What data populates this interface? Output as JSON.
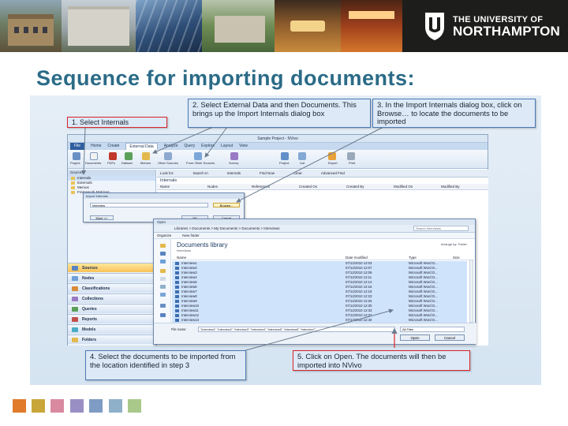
{
  "header": {
    "logo_line1": "THE UNIVERSITY OF",
    "logo_line2": "NORTHAMPTON"
  },
  "title": "Sequence for importing documents:",
  "callouts": {
    "step1": "1. Select Internals",
    "step2": "2. Select External Data and then Documents. This brings up the Import Internals dialog box",
    "step3": "3. In the Import Internals dialog box, click on Browse… to locate the documents to be imported",
    "step4": "4. Select the documents to be imported from the location identified in step 3",
    "step5": "5. Click on Open. The documents will then be imported into NVivo"
  },
  "nvivo": {
    "window_title": "Sample Project - NVivo",
    "tabs": [
      "File",
      "Home",
      "Create",
      "External Data",
      "Analyze",
      "Query",
      "Explore",
      "Layout",
      "View"
    ],
    "ribbon": [
      "Project",
      "Documents",
      "PDFs",
      "Dataset",
      "Memos",
      "Other Sources",
      "From Other Sources",
      "Survey",
      "Project",
      "List",
      "Export",
      "Print"
    ],
    "left_header": "Sources",
    "tree": [
      "Internals",
      "Externals",
      "Memos",
      "Framework Matrices"
    ],
    "nav": [
      "Sources",
      "Nodes",
      "Classifications",
      "Collections",
      "Queries",
      "Reports",
      "Models",
      "Folders"
    ],
    "find_bar": [
      "Look for:",
      "Search In",
      "Internals",
      "Find Now",
      "Clear",
      "Advanced Find"
    ],
    "list_title": "Internals",
    "columns": [
      "Name",
      "Nodes",
      "References",
      "Created On",
      "Created By",
      "Modified On",
      "Modified By"
    ]
  },
  "import_dialog": {
    "title": "Import Internals",
    "field_value": "Interview",
    "browse": "Browse...",
    "more": "More >>",
    "ok": "OK",
    "cancel": "Cancel"
  },
  "open_dialog": {
    "title": "Open",
    "path": "Libraries > Documents > My Documents > Documents > Interviews",
    "search": "Search Interviews",
    "toolbar": [
      "Organize",
      "New folder"
    ],
    "library_title": "Documents library",
    "library_sub": "Interviews",
    "arrange_by": "Arrange by: Folder",
    "columns": [
      "Name",
      "Date modified",
      "Type",
      "Size"
    ],
    "files": [
      {
        "name": "Interview1",
        "date": "07/12/2010 12:03",
        "type": "Microsoft Word D..."
      },
      {
        "name": "Interview2",
        "date": "07/12/2010 12:07",
        "type": "Microsoft Word D..."
      },
      {
        "name": "Interview3",
        "date": "07/12/2010 12:09",
        "type": "Microsoft Word D..."
      },
      {
        "name": "Interview4",
        "date": "07/12/2010 12:11",
        "type": "Microsoft Word D..."
      },
      {
        "name": "Interview5",
        "date": "07/12/2010 12:14",
        "type": "Microsoft Word D..."
      },
      {
        "name": "Interview6",
        "date": "07/12/2010 12:16",
        "type": "Microsoft Word D..."
      },
      {
        "name": "Interview7",
        "date": "07/12/2010 12:19",
        "type": "Microsoft Word D..."
      },
      {
        "name": "Interview8",
        "date": "07/12/2010 12:23",
        "type": "Microsoft Word D..."
      },
      {
        "name": "Interview9",
        "date": "07/12/2010 12:26",
        "type": "Microsoft Word D..."
      },
      {
        "name": "Interview10",
        "date": "07/12/2010 12:30",
        "type": "Microsoft Word D..."
      },
      {
        "name": "Interview11",
        "date": "07/12/2010 12:33",
        "type": "Microsoft Word D..."
      },
      {
        "name": "Interview12",
        "date": "07/12/2010 12:37",
        "type": "Microsoft Word D..."
      },
      {
        "name": "Interview13",
        "date": "07/12/2010 12:40",
        "type": "Microsoft Word D..."
      },
      {
        "name": "Interview14",
        "date": "07/12/2010 12:44",
        "type": "Microsoft Word D..."
      },
      {
        "name": "Interview15",
        "date": "07/12/2010 12:47",
        "type": "Microsoft Word D..."
      }
    ],
    "filename_label": "File name:",
    "filename_value": "\"Interview1\" \"Interview2\" \"Interview3\" \"Interview4\" \"Interview5\" \"Interview6\" \"Interview7\"",
    "type_value": "All Files",
    "open": "Open",
    "cancel": "Cancel"
  },
  "footer_colors": [
    "#e07b2a",
    "#c9a63a",
    "#d98aa0",
    "#9a8fc4",
    "#7e9cc4",
    "#8fb0c9",
    "#a8c98a"
  ]
}
